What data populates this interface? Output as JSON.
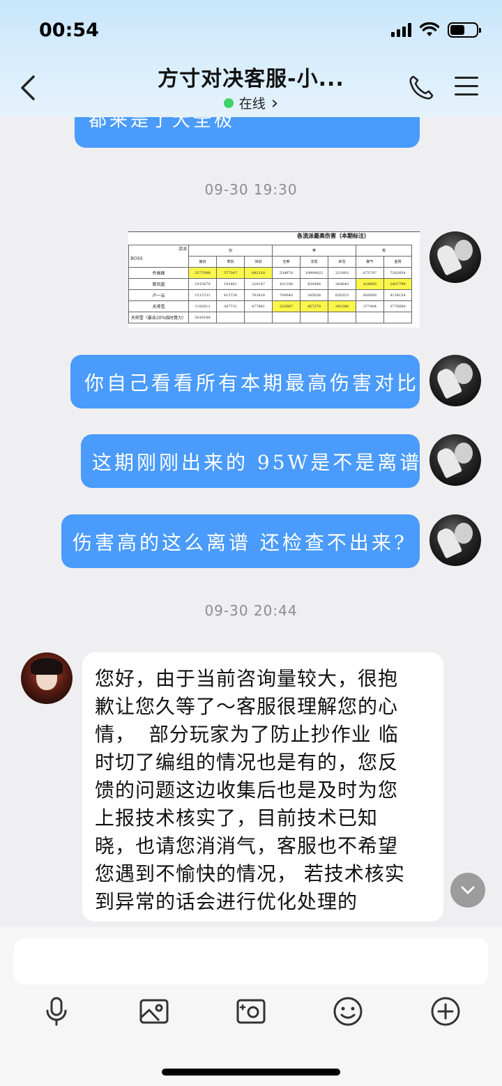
{
  "status": {
    "time": "00:54"
  },
  "header": {
    "title": "方寸对决客服-小...",
    "online_label": "在线",
    "online_chevron": "›"
  },
  "messages": {
    "partial_top": "都来是了大全极",
    "timestamp_1": "09-30 19:30",
    "table_image": {
      "caption": "各流派最高伤害（本期标注）",
      "group_header": [
        "流派",
        "剑",
        "拳",
        "棍"
      ],
      "corner_label": "BOSS",
      "sub_headers": [
        "傲剑",
        "寒剑",
        "快剑",
        "空拳",
        "龙斑",
        "醉龙",
        "聚气",
        "金刚"
      ],
      "rows": [
        {
          "name": "乔高峰",
          "values": [
            "2577098",
            "377347",
            "842110",
            "534678",
            "19999922",
            "321903",
            "673797",
            "7302604"
          ]
        },
        {
          "name": "紫凤凰",
          "values": [
            "1015679",
            "193461",
            "220187",
            "431198",
            "450946",
            "264640",
            "428993",
            "2407799"
          ]
        },
        {
          "name": "卢一云",
          "values": [
            "1513731",
            "413734",
            "703424",
            "700040",
            "345636",
            "630353",
            "600000",
            "4134154"
          ]
        },
        {
          "name": "天帅雪",
          "values": [
            "1183011",
            "307731",
            "477861",
            "323087",
            "457270",
            "341286",
            "377494",
            "3776680"
          ]
        },
        {
          "name": "天帅雪（暴击20%临时算力）",
          "values": [
            "5018188",
            "",
            "",
            "",
            "",
            "",
            "",
            ""
          ]
        }
      ]
    },
    "out_1": "你自己看看所有本期最高伤害对比",
    "out_2": "这期刚刚出来的 95W是不是离谱",
    "out_3": "伤害高的这么离谱 还检查不出来?",
    "timestamp_2": "09-30 20:44",
    "in_1_lines": [
      "您好，由于当前咨询量较大，很抱",
      "歉让您久等了～客服很理解您的心",
      "情，  部分玩家为了防止抄作业 临",
      "时切了编组的情况也是有的，您反",
      "馈的问题这边收集后也是及时为您",
      "上报技术核实了，目前技术已知",
      "晓，也请您消消气，客服也不希望",
      "您遇到不愉快的情况， 若技术核实",
      "到异常的话会进行优化处理的"
    ]
  },
  "toolbar": {
    "icons": [
      "microphone-icon",
      "image-icon",
      "camera-icon",
      "emoji-icon",
      "plus-icon"
    ]
  },
  "colors": {
    "bubble_out": "#4a9bfb",
    "bubble_in": "#ffffff",
    "online_dot": "#3ed36a",
    "highlight": "#fbf64a"
  }
}
